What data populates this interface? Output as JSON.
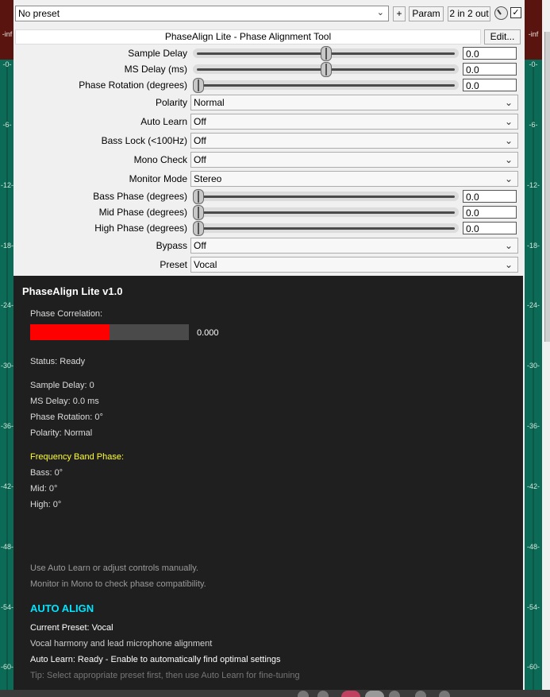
{
  "toolbar": {
    "preset_value": "No preset",
    "plus_label": "+",
    "param_label": "Param",
    "io_label": "2 in 2 out"
  },
  "header": {
    "title": "PhaseAlign Lite - Phase Alignment Tool",
    "edit_label": "Edit..."
  },
  "meters": {
    "cap": "-inf",
    "ticks": [
      "-0-",
      "-6-",
      "-12-",
      "-18-",
      "-24-",
      "-30-",
      "-36-",
      "-42-",
      "-48-",
      "-54-",
      "-60-"
    ]
  },
  "params": {
    "sample_delay": {
      "label": "Sample Delay",
      "value": "0.0",
      "position": 0.5
    },
    "ms_delay": {
      "label": "MS Delay (ms)",
      "value": "0.0",
      "position": 0.5
    },
    "phase_rotation": {
      "label": "Phase Rotation (degrees)",
      "value": "0.0",
      "position": 0.0
    },
    "polarity": {
      "label": "Polarity",
      "value": "Normal"
    },
    "auto_learn": {
      "label": "Auto Learn",
      "value": "Off"
    },
    "bass_lock": {
      "label": "Bass Lock (<100Hz)",
      "value": "Off"
    },
    "mono_check": {
      "label": "Mono Check",
      "value": "Off"
    },
    "monitor_mode": {
      "label": "Monitor Mode",
      "value": "Stereo"
    },
    "bass_phase": {
      "label": "Bass Phase (degrees)",
      "value": "0.0",
      "position": 0.0
    },
    "mid_phase": {
      "label": "Mid Phase (degrees)",
      "value": "0.0",
      "position": 0.0
    },
    "high_phase": {
      "label": "High Phase (degrees)",
      "value": "0.0",
      "position": 0.0
    },
    "bypass": {
      "label": "Bypass",
      "value": "Off"
    },
    "preset": {
      "label": "Preset",
      "value": "Vocal"
    }
  },
  "display": {
    "title": "PhaseAlign Lite v1.0",
    "correlation_label": "Phase Correlation:",
    "correlation_value": "0.000",
    "correlation_fill": 0.5,
    "status": "Status: Ready",
    "sample_delay": "Sample Delay: 0",
    "ms_delay": "MS Delay: 0.0 ms",
    "phase_rotation": "Phase Rotation: 0°",
    "polarity": "Polarity: Normal",
    "freq_heading": "Frequency Band Phase:",
    "bass": "Bass: 0°",
    "mid": "Mid: 0°",
    "high": "High: 0°",
    "hint1": "Use Auto Learn or adjust controls manually.",
    "hint2": "Monitor in Mono to check phase compatibility.",
    "auto_align": "AUTO ALIGN",
    "current_preset": "Current Preset: Vocal",
    "preset_desc": "Vocal harmony and lead microphone alignment",
    "auto_learn_status": "Auto Learn: Ready - Enable to automatically find optimal settings",
    "tip": "Tip: Select appropriate preset first, then use Auto Learn for fine-tuning"
  },
  "colors": {
    "meter_green": "#0c6b57",
    "meter_red": "#5a1410",
    "correlation_red": "#ff0000",
    "freq_heading": "#ffff33",
    "auto_align": "#00e5ff"
  }
}
